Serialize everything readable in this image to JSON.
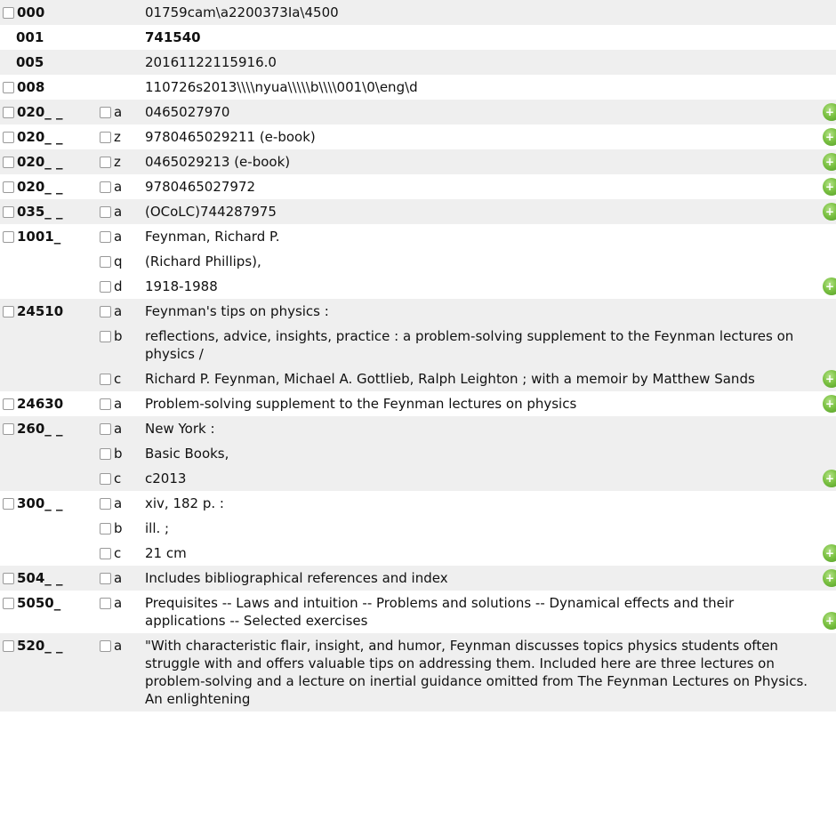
{
  "fields": [
    {
      "tag": "000",
      "checkbox": true,
      "bold": false,
      "subfields": [
        {
          "code": "",
          "checkbox": false,
          "value": "01759cam\\a2200373Ia\\4500"
        }
      ],
      "add_icon": false
    },
    {
      "tag": "001",
      "checkbox": false,
      "bold": true,
      "subfields": [
        {
          "code": "",
          "checkbox": false,
          "value": "741540"
        }
      ],
      "add_icon": false
    },
    {
      "tag": "005",
      "checkbox": false,
      "bold": false,
      "subfields": [
        {
          "code": "",
          "checkbox": false,
          "value": "20161122115916.0"
        }
      ],
      "add_icon": false
    },
    {
      "tag": "008",
      "checkbox": true,
      "bold": false,
      "subfields": [
        {
          "code": "",
          "checkbox": false,
          "value": "110726s2013\\\\\\\\nyua\\\\\\\\\\b\\\\\\\\001\\0\\eng\\d"
        }
      ],
      "add_icon": false
    },
    {
      "tag": "020_ _",
      "checkbox": true,
      "bold": false,
      "subfields": [
        {
          "code": "a",
          "checkbox": true,
          "value": "0465027970"
        }
      ],
      "add_icon": true
    },
    {
      "tag": "020_ _",
      "checkbox": true,
      "bold": false,
      "subfields": [
        {
          "code": "z",
          "checkbox": true,
          "value": "9780465029211 (e-book)"
        }
      ],
      "add_icon": true
    },
    {
      "tag": "020_ _",
      "checkbox": true,
      "bold": false,
      "subfields": [
        {
          "code": "z",
          "checkbox": true,
          "value": "0465029213 (e-book)"
        }
      ],
      "add_icon": true
    },
    {
      "tag": "020_ _",
      "checkbox": true,
      "bold": false,
      "subfields": [
        {
          "code": "a",
          "checkbox": true,
          "value": "9780465027972"
        }
      ],
      "add_icon": true
    },
    {
      "tag": "035_ _",
      "checkbox": true,
      "bold": false,
      "subfields": [
        {
          "code": "a",
          "checkbox": true,
          "value": "(OCoLC)744287975"
        }
      ],
      "add_icon": true
    },
    {
      "tag": "1001_",
      "checkbox": true,
      "bold": false,
      "subfields": [
        {
          "code": "a",
          "checkbox": true,
          "value": "Feynman, Richard P."
        },
        {
          "code": "q",
          "checkbox": true,
          "value": "(Richard Phillips),"
        },
        {
          "code": "d",
          "checkbox": true,
          "value": "1918-1988"
        }
      ],
      "add_icon": true
    },
    {
      "tag": "24510",
      "checkbox": true,
      "bold": false,
      "subfields": [
        {
          "code": "a",
          "checkbox": true,
          "value": "Feynman's tips on physics :"
        },
        {
          "code": "b",
          "checkbox": true,
          "value": "reflections, advice, insights, practice : a problem-solving supplement to the Feynman lectures on physics /"
        },
        {
          "code": "c",
          "checkbox": true,
          "value": "Richard P. Feynman, Michael A. Gottlieb, Ralph Leighton ; with a memoir by Matthew Sands"
        }
      ],
      "add_icon": true
    },
    {
      "tag": "24630",
      "checkbox": true,
      "bold": false,
      "subfields": [
        {
          "code": "a",
          "checkbox": true,
          "value": "Problem-solving supplement to the Feynman lectures on physics"
        }
      ],
      "add_icon": true
    },
    {
      "tag": "260_ _",
      "checkbox": true,
      "bold": false,
      "subfields": [
        {
          "code": "a",
          "checkbox": true,
          "value": "New York :"
        },
        {
          "code": "b",
          "checkbox": true,
          "value": "Basic Books,"
        },
        {
          "code": "c",
          "checkbox": true,
          "value": "c2013"
        }
      ],
      "add_icon": true
    },
    {
      "tag": "300_ _",
      "checkbox": true,
      "bold": false,
      "subfields": [
        {
          "code": "a",
          "checkbox": true,
          "value": "xiv, 182 p. :"
        },
        {
          "code": "b",
          "checkbox": true,
          "value": "ill. ;"
        },
        {
          "code": "c",
          "checkbox": true,
          "value": "21 cm"
        }
      ],
      "add_icon": true
    },
    {
      "tag": "504_ _",
      "checkbox": true,
      "bold": false,
      "subfields": [
        {
          "code": "a",
          "checkbox": true,
          "value": "Includes bibliographical references and index"
        }
      ],
      "add_icon": true
    },
    {
      "tag": "5050_",
      "checkbox": true,
      "bold": false,
      "subfields": [
        {
          "code": "a",
          "checkbox": true,
          "value": "Prequisites -- Laws and intuition -- Problems and solutions -- Dynamical effects and their applications -- Selected exercises"
        }
      ],
      "add_icon": true
    },
    {
      "tag": "520_ _",
      "checkbox": true,
      "bold": false,
      "subfields": [
        {
          "code": "a",
          "checkbox": true,
          "value": "\"With characteristic flair, insight, and humor, Feynman discusses topics physics students often struggle with and offers valuable tips on addressing them. Included here are three lectures on problem-solving and a lecture on inertial guidance omitted from The Feynman Lectures on Physics. An enlightening"
        }
      ],
      "add_icon": false
    }
  ],
  "add_icon_name": "green-add-icon",
  "colors": {
    "shade": "#efefef",
    "add_icon": "#6fb83a"
  }
}
